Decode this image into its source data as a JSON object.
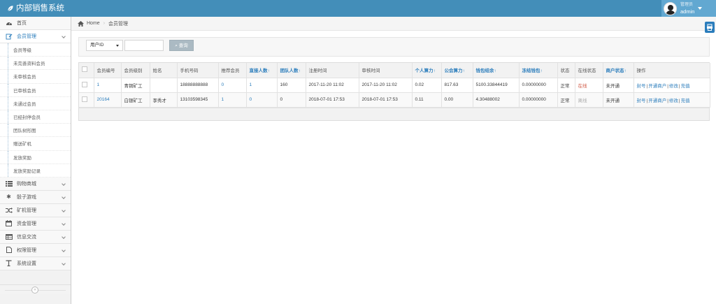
{
  "app": {
    "title": "内部销售系统"
  },
  "user": {
    "welcome": "管理员",
    "name": "admin"
  },
  "breadcrumb": {
    "home": "Home",
    "current": "会员管理"
  },
  "sidebar": {
    "items": [
      {
        "label": "首页",
        "icon": "dashboard-icon"
      },
      {
        "label": "会员管理",
        "icon": "user-edit-icon",
        "expanded": true,
        "children": [
          "会员等级",
          "未完善资料会员",
          "未审核会员",
          "已审核会员",
          "未通过会员",
          "已经封停会员",
          "团队树形图",
          "赠送矿机",
          "发放奖励",
          "发放奖励记录"
        ]
      },
      {
        "label": "购物商城",
        "icon": "list-icon"
      },
      {
        "label": "骰子游戏",
        "icon": "asterisk-icon"
      },
      {
        "label": "矿机管理",
        "icon": "shuffle-icon"
      },
      {
        "label": "资金管理",
        "icon": "calendar-icon"
      },
      {
        "label": "信息交流",
        "icon": "table-icon"
      },
      {
        "label": "权限管理",
        "icon": "file-icon"
      },
      {
        "label": "系统设置",
        "icon": "text-icon"
      }
    ]
  },
  "filter": {
    "select_value": "用户ID",
    "input_value": "",
    "search_label": "查询"
  },
  "table": {
    "headers": [
      "会员编号",
      "会员级别",
      "姓名",
      "手机号码",
      "推荐会员",
      "直接人数↑",
      "团队人数↑",
      "注册时间",
      "审核时间",
      "个人算力↑",
      "公会算力↑",
      "钱包结余↑",
      "冻结钱包↑",
      "状态",
      "在线状态",
      "商户状态↑",
      "操作"
    ],
    "rows": [
      {
        "id": "1",
        "level": "青铜矿工",
        "name": "",
        "phone": "18888888888",
        "referrer": "0",
        "direct": "1",
        "team": "160",
        "reg_time": "2017-11-20 11:02",
        "audit_time": "2017-11-20 11:02",
        "personal": "0.02",
        "guild": "817.63",
        "wallet": "5100.33844419",
        "frozen": "0.00000000",
        "status": "正常",
        "online": "在线",
        "merchant": "未开通",
        "ops": [
          "封号",
          "开通商户",
          "修改",
          "充值"
        ]
      },
      {
        "id": "20164",
        "level": "白银矿工",
        "name": "李秀才",
        "phone": "13103598345",
        "referrer": "1",
        "direct": "0",
        "team": "0",
        "reg_time": "2018-07-01 17:53",
        "audit_time": "2018-07-01 17:53",
        "personal": "0.11",
        "guild": "0.00",
        "wallet": "4.30488002",
        "frozen": "0.00000000",
        "status": "正常",
        "online": "离线",
        "merchant": "未开通",
        "ops": [
          "封号",
          "开通商户",
          "修改",
          "充值"
        ]
      }
    ]
  },
  "colors": {
    "navbar": "#438eb9",
    "accent": "#2b7dbc",
    "online": "#d15b47"
  }
}
